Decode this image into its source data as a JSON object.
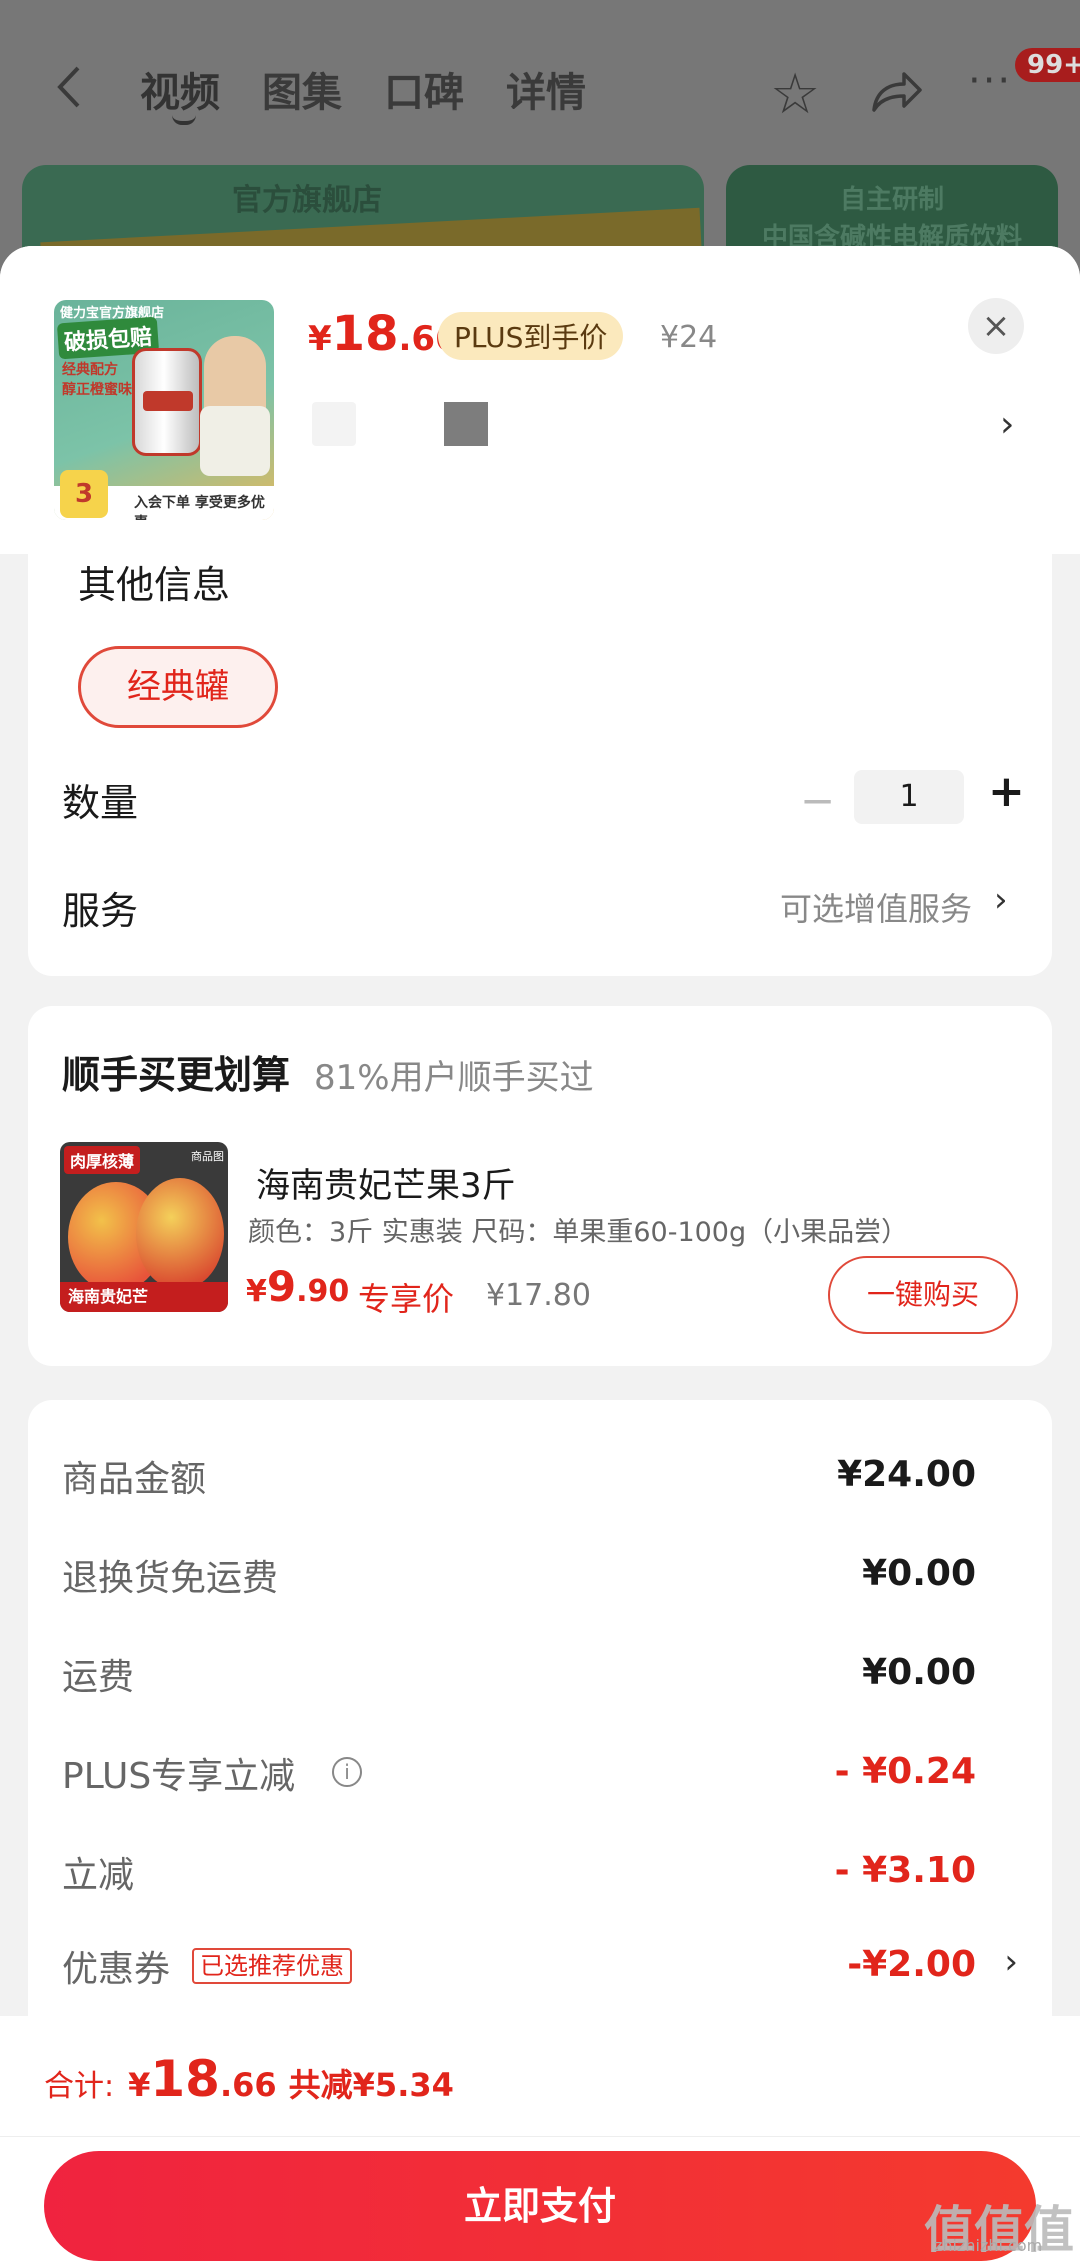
{
  "background_page": {
    "tabs": [
      "视频",
      "图集",
      "口碑",
      "详情"
    ],
    "badge": "99+",
    "banner_left_text": "官方旗舰店",
    "banner_right_line1": "自主研制",
    "banner_right_line2": "中国含碱性电解质饮料"
  },
  "header": {
    "thumb_shop": "健力宝官方旗舰店",
    "thumb_tag": "破损包赔",
    "thumb_sub1": "经典配方",
    "thumb_sub2": "醇正橙蜜味",
    "thumb_footer": "入会下单 享受更多优惠",
    "thumb_num": "3",
    "price_currency": "¥",
    "price_int": "18",
    "price_dec": ".66",
    "plus_label": "PLUS到手价",
    "original_price": "¥24",
    "close_symbol": "×",
    "chevron": "›"
  },
  "options": {
    "other_info_title": "其他信息",
    "variant_label": "经典罐",
    "quantity_label": "数量",
    "quantity_value": "1",
    "minus": "−",
    "plus": "+",
    "service_label": "服务",
    "service_value": "可选增值服务",
    "chevron": "›"
  },
  "bundle": {
    "title": "顺手买更划算",
    "subtitle": "81%用户顺手买过",
    "item_badge": "肉厚核薄",
    "item_badge2": "商品图",
    "item_footer": "海南贵妃芒",
    "item_name": "海南贵妃芒果3斤",
    "item_spec": "颜色：3斤 实惠装   尺码：单果重60-100g（小果品尝）",
    "price_currency": "¥",
    "price_int": "9",
    "price_dec": ".90",
    "price_tag": "专享价",
    "original_price": "¥17.80",
    "buy_label": "一键购买"
  },
  "summary": {
    "rows": [
      {
        "label": "商品金额",
        "value": "¥24.00"
      },
      {
        "label": "退换货免运费",
        "value": "¥0.00"
      },
      {
        "label": "运费",
        "value": "¥0.00"
      },
      {
        "label": "PLUS专享立减",
        "value": "- ¥0.24"
      },
      {
        "label": "立减",
        "value": "- ¥3.10"
      },
      {
        "label": "优惠券",
        "value": "-¥2.00"
      }
    ],
    "coupon_tag": "已选推荐优惠",
    "info_symbol": "i",
    "chevron": "›"
  },
  "footer": {
    "total_label": "合计:",
    "total_currency": "¥",
    "total_int": "18",
    "total_dec": ".66",
    "total_saving": "共减¥5.34",
    "pay_label": "立即支付",
    "watermark": "值值值",
    "watermark_sub": "zhizhizhi.com"
  },
  "colors": {
    "accent": "#e1251b",
    "pay_gradient_start": "#f0233f",
    "pay_gradient_end": "#f43a2e",
    "plus_tag_bg": "#fbe9bd"
  }
}
